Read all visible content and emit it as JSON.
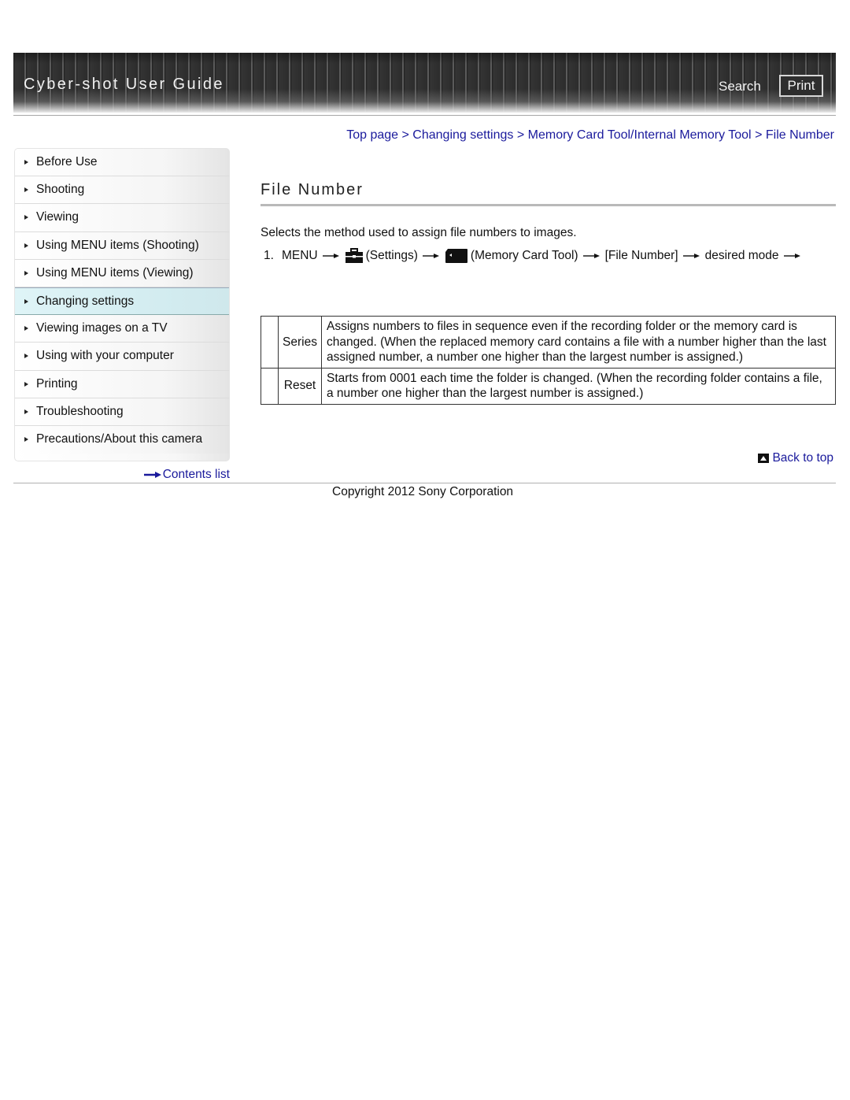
{
  "header": {
    "title": "Cyber-shot User Guide",
    "search_label": "Search",
    "print_label": "Print"
  },
  "breadcrumb": {
    "items": [
      "Top page",
      "Changing settings",
      "Memory Card Tool/Internal Memory Tool",
      "File Number"
    ],
    "separator": ">"
  },
  "sidebar": {
    "items": [
      {
        "label": "Before Use",
        "active": false
      },
      {
        "label": "Shooting",
        "active": false
      },
      {
        "label": "Viewing",
        "active": false
      },
      {
        "label": "Using MENU items (Shooting)",
        "active": false
      },
      {
        "label": "Using MENU items (Viewing)",
        "active": false
      },
      {
        "label": "Changing settings",
        "active": true
      },
      {
        "label": "Viewing images on a TV",
        "active": false
      },
      {
        "label": "Using with your computer",
        "active": false
      },
      {
        "label": "Printing",
        "active": false
      },
      {
        "label": "Troubleshooting",
        "active": false
      },
      {
        "label": "Precautions/About this camera",
        "active": false
      }
    ],
    "contents_link": "Contents list"
  },
  "main": {
    "title": "File Number",
    "intro": "Selects the method used to assign file numbers to images.",
    "step": {
      "number": "1.",
      "menu": "MENU",
      "settings_icon": "settings-toolbox-icon",
      "settings": "(Settings)",
      "card_icon": "memory-card-icon",
      "card_tool": "(Memory Card Tool)",
      "file_number": "[File Number]",
      "desired_mode": "desired mode"
    },
    "modes": [
      {
        "name": "Series",
        "description": "Assigns numbers to files in sequence even if the recording folder or the memory card is changed. (When the replaced memory card contains a file with a number higher than the last assigned number, a number one higher than the largest number is assigned.)"
      },
      {
        "name": "Reset",
        "description": "Starts from 0001 each time the folder is changed. (When the recording folder contains a file, a number one higher than the largest number is assigned.)"
      }
    ]
  },
  "footer": {
    "back_to_top": "Back to top",
    "copyright": "Copyright 2012 Sony Corporation"
  },
  "colors": {
    "link": "#1a1a9c",
    "banner": "#2e2e2e",
    "active_nav": "#d4edf1"
  }
}
